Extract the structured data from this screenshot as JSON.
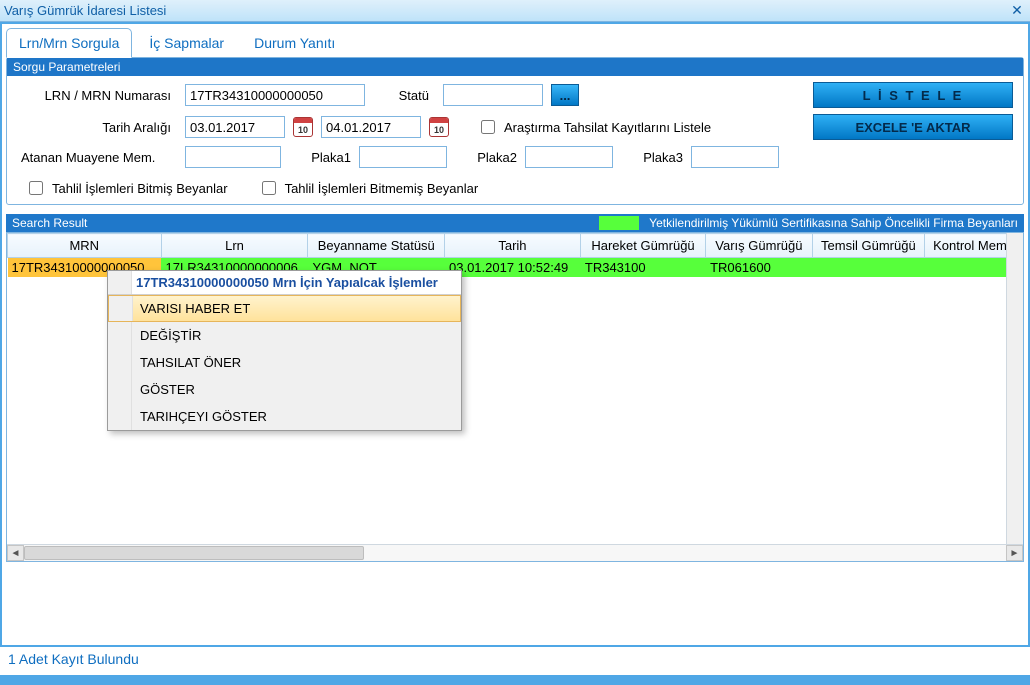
{
  "window": {
    "title": "Varış Gümrük İdaresi Listesi"
  },
  "tabs": [
    {
      "label": "Lrn/Mrn Sorgula"
    },
    {
      "label": "İç Sapmalar"
    },
    {
      "label": "Durum Yanıtı"
    }
  ],
  "query": {
    "panel_title": "Sorgu Parametreleri",
    "labels": {
      "lrn_mrn": "LRN / MRN Numarası",
      "statu": "Statü",
      "tarih_araligi": "Tarih Aralığı",
      "arastirma_tahsilat": "Araştırma Tahsilat Kayıtlarını Listele",
      "atanan_muayene": "Atanan Muayene Mem.",
      "plaka1": "Plaka1",
      "plaka2": "Plaka2",
      "plaka3": "Plaka3",
      "tahlil_bitmis": "Tahlil İşlemleri Bitmiş Beyanlar",
      "tahlil_bitmemis": "Tahlil İşlemleri Bitmemiş Beyanlar"
    },
    "values": {
      "lrn_mrn": "17TR34310000000050",
      "statu": "",
      "date_from": "03.01.2017",
      "date_to": "04.01.2017",
      "cal_day": "10",
      "atanan_muayene": "",
      "plaka1": "",
      "plaka2": "",
      "plaka3": ""
    },
    "buttons": {
      "listele": "L İ S T E L E",
      "excel": "EXCELE 'E AKTAR",
      "dots": "..."
    }
  },
  "result": {
    "panel_title": "Search Result",
    "legend_text": "Yetkilendirilmiş Yükümlü Sertifikasına Sahip Öncelikli Firma Beyanları",
    "columns": [
      "MRN",
      "Lrn",
      "Beyanname Statüsü",
      "Tarih",
      "Hareket Gümrüğü",
      "Varış Gümrüğü",
      "Temsil Gümrüğü",
      "Kontrol Memu"
    ],
    "rows": [
      {
        "mrn": "17TR34310000000050",
        "lrn": "17LR34310000000006",
        "statu": "YGM_NOT",
        "tarih": "03.01.2017 10:52:49",
        "hareket": "TR343100",
        "varis": "TR061600",
        "temsil": "",
        "kontrol": ""
      }
    ]
  },
  "context_menu": {
    "title": "17TR34310000000050 Mrn İçin Yapıalcak İşlemler",
    "items": [
      "VARISI HABER ET",
      "DEĞİŞTİR",
      "TAHSILAT ÖNER",
      "GÖSTER",
      "TARIHÇEYI GÖSTER"
    ]
  },
  "status_bar": "1  Adet Kayıt Bulundu"
}
